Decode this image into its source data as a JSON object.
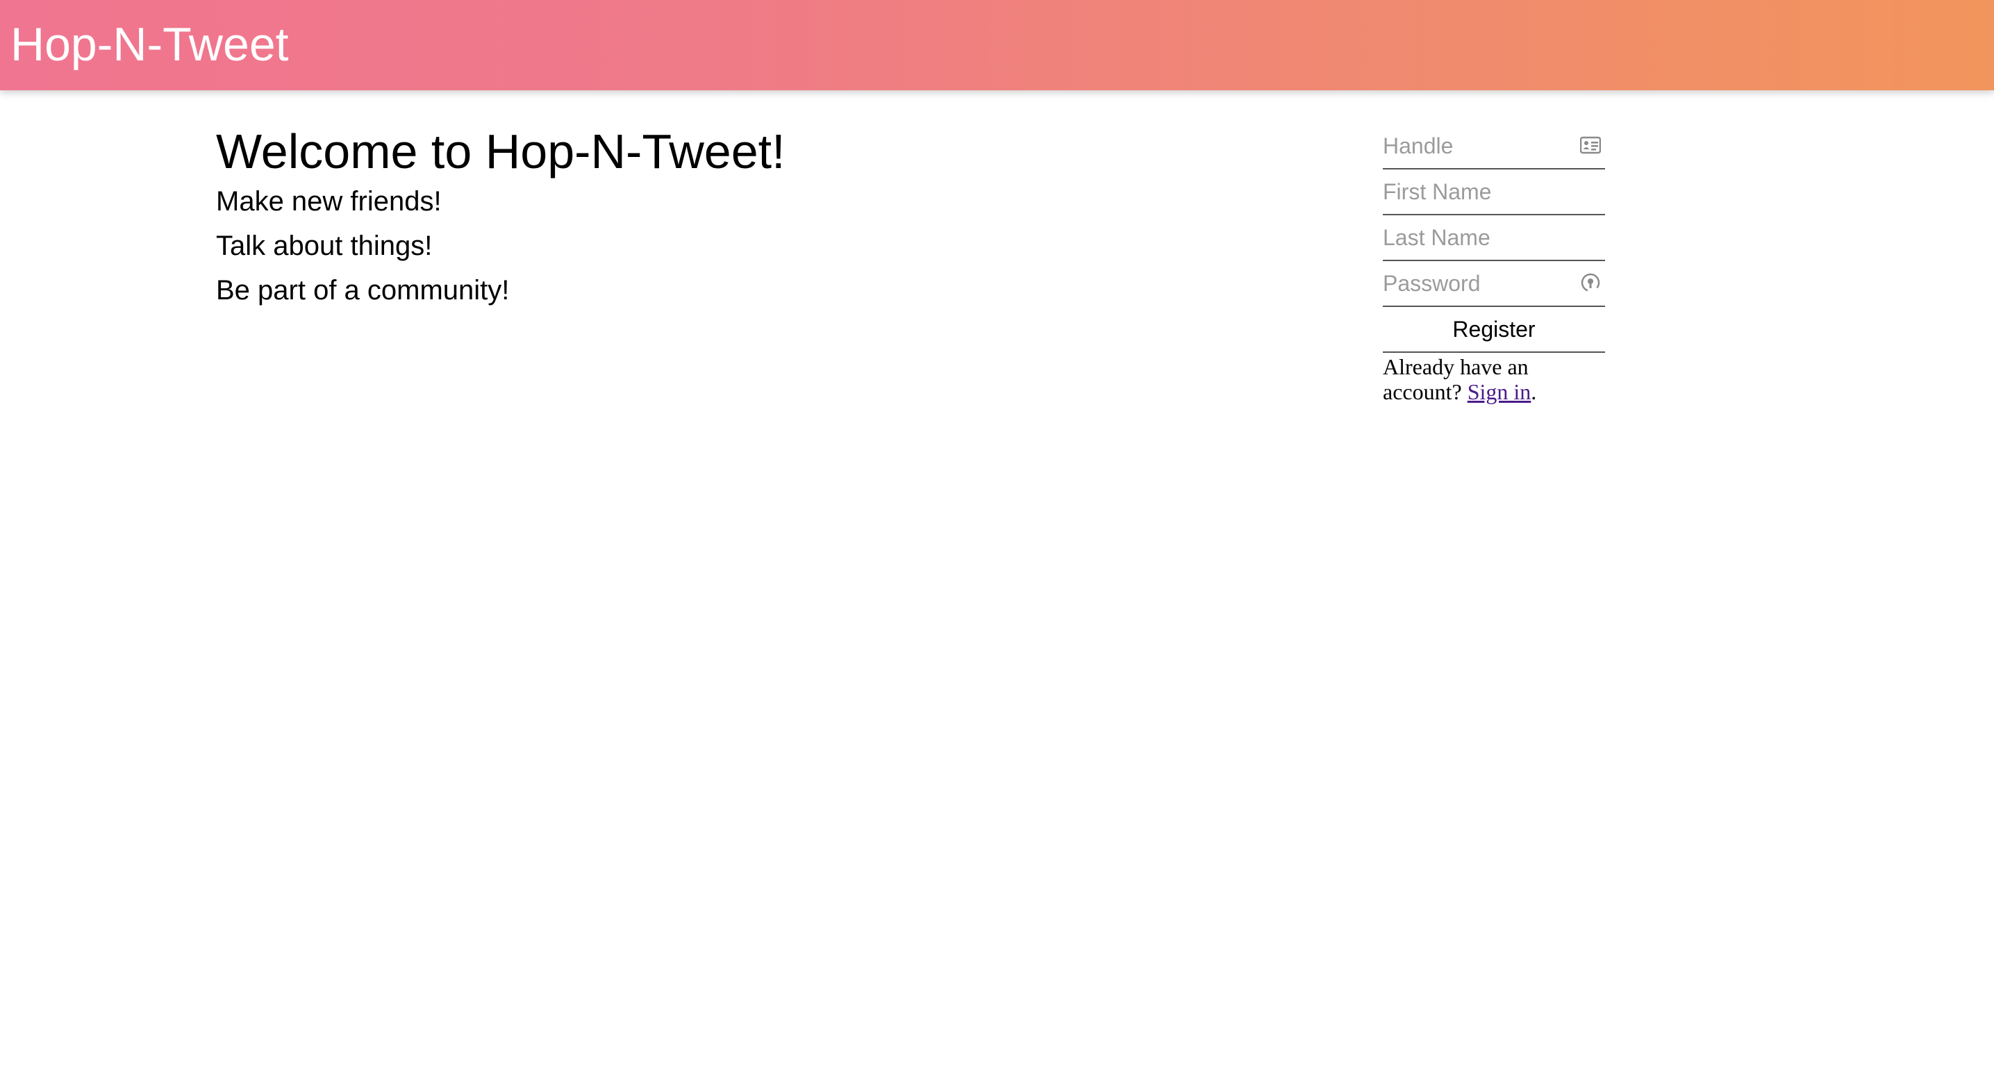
{
  "header": {
    "brand": "Hop-N-Tweet"
  },
  "welcome": {
    "title": "Welcome to Hop-N-Tweet!",
    "taglines": [
      "Make new friends!",
      "Talk about things!",
      "Be part of a community!"
    ]
  },
  "register_form": {
    "handle_placeholder": "Handle",
    "first_name_placeholder": "First Name",
    "last_name_placeholder": "Last Name",
    "password_placeholder": "Password",
    "register_label": "Register",
    "signin_prefix": "Already have an account? ",
    "signin_link": "Sign in",
    "signin_suffix": "."
  },
  "icons": {
    "handle": "contact-card-icon",
    "password": "password-key-icon"
  },
  "colors": {
    "header_gradient_start": "#f07590",
    "header_gradient_end": "#f2955c",
    "link": "#4b1b8a"
  }
}
